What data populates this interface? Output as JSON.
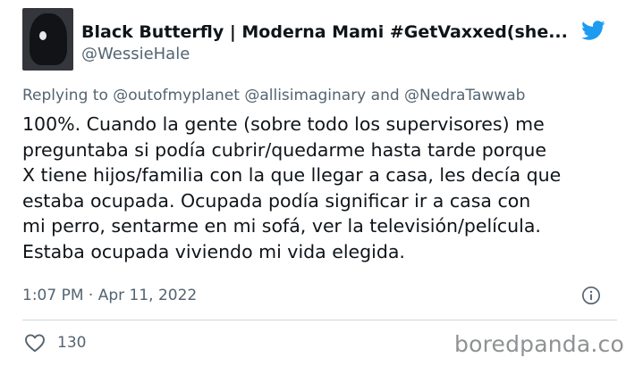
{
  "tweet": {
    "display_name": "Black Butterfly | Moderna Mami #GetVaxxed(she...",
    "handle": "@WessieHale",
    "replying": {
      "prefix": "Replying to",
      "mentions": [
        "@outofmyplanet",
        "@allisimaginary",
        "@NedraTawwab"
      ],
      "joiner": "and"
    },
    "text_lines": [
      "100%. Cuando la gente (sobre todo los supervisores) me",
      "preguntaba si podía cubrir/quedarme hasta tarde porque",
      "X tiene hijos/familia con la que llegar a casa, les decía que",
      "estaba ocupada. Ocupada podía significar ir a casa con",
      "mi perro, sentarme en mi sofá, ver la televisión/película.",
      "Estaba ocupada viviendo mi vida elegida."
    ],
    "timestamp": "1:07 PM · Apr 11, 2022",
    "like_count": "130"
  },
  "icons": {
    "brand": "twitter-bird-icon",
    "info": "info-icon",
    "like": "heart-icon"
  },
  "watermark": "boredpanda.com",
  "colors": {
    "twitter_blue": "#1d9bf0",
    "text_primary": "#0f1419",
    "text_secondary": "#536471",
    "divider": "#cfd9de",
    "watermark": "#8f9193"
  }
}
